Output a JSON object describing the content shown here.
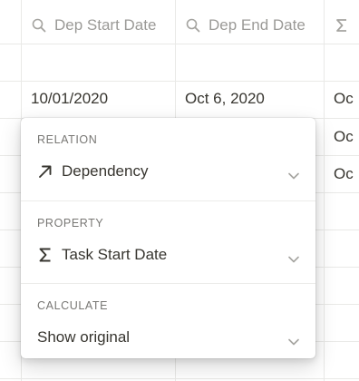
{
  "table": {
    "columns": [
      {
        "label": "Dep Start Date",
        "icon": "search-icon"
      },
      {
        "label": "Dep End Date",
        "icon": "search-icon"
      },
      {
        "label": "",
        "icon": "sigma-icon"
      }
    ],
    "rows": [
      {
        "dep_start": "",
        "dep_end": "",
        "sigma": ""
      },
      {
        "dep_start": "10/01/2020",
        "dep_end": "Oct 6, 2020",
        "sigma": "Oc"
      },
      {
        "dep_start": "",
        "dep_end": "",
        "sigma": "Oc"
      },
      {
        "dep_start": "",
        "dep_end": "",
        "sigma": "Oc"
      }
    ]
  },
  "popover": {
    "relation": {
      "label": "RELATION",
      "value": "Dependency",
      "icon": "arrow-up-right-icon"
    },
    "property": {
      "label": "PROPERTY",
      "value": "Task Start Date",
      "icon": "sigma-icon"
    },
    "calculate": {
      "label": "CALCULATE",
      "value": "Show original"
    }
  }
}
